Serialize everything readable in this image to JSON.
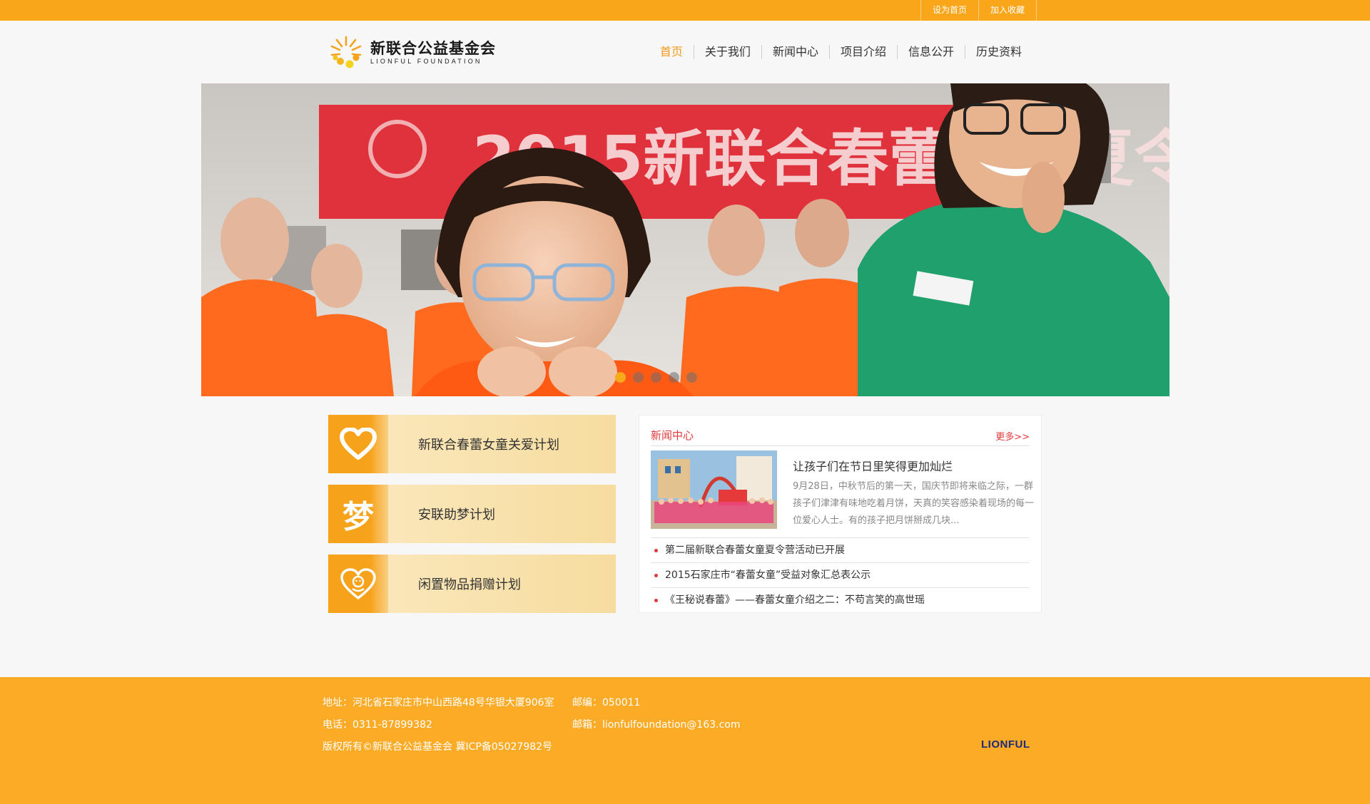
{
  "topbar": {
    "set_home": "设为首页",
    "favorite": "加入收藏"
  },
  "logo": {
    "name_cn": "新联合公益基金会",
    "name_en": "LIONFUL FOUNDATION"
  },
  "nav": [
    "首页",
    "关于我们",
    "新闻中心",
    "项目介绍",
    "信息公开",
    "历史资料"
  ],
  "banner": {
    "caption": "2015新联合春蕾女童夏令",
    "slides": 5,
    "active_slide": 1
  },
  "projects": [
    {
      "label": "新联合春蕾女童关爱计划",
      "icon": "heart-icon"
    },
    {
      "label": "安联助梦计划",
      "icon": "dream-char-icon",
      "glyph": "梦"
    },
    {
      "label": "闲置物品捐赠计划",
      "icon": "heart-face-icon"
    }
  ],
  "news": {
    "title": "新闻中心",
    "more": "更多>>",
    "featured": {
      "title": "让孩子们在节日里笑得更加灿烂",
      "summary": "9月28日，中秋节后的第一天，国庆节即将来临之际，一群孩子们津津有味地吃着月饼，天真的笑容感染着现场的每一位爱心人士。有的孩子把月饼掰成几块..."
    },
    "items": [
      "第二届新联合春蕾女童夏令营活动已开展",
      "2015石家庄市“春蕾女童”受益对象汇总表公示",
      "《王秘说春蕾》——春蕾女童介绍之二：不苟言笑的高世瑶"
    ]
  },
  "footer": {
    "address": "地址：河北省石家庄市中山西路48号华银大厦906室",
    "phone": "电话：0311-87899382",
    "copyright": "版权所有©新联合公益基金会 冀ICP备05027982号",
    "postcode": "邮编：050011",
    "email": "邮箱：lionfulfoundation@163.com",
    "logo": "LIONFUL"
  },
  "colors": {
    "accent": "#f9a61a",
    "news_red": "#e4393c",
    "footer": "#fbab26"
  }
}
